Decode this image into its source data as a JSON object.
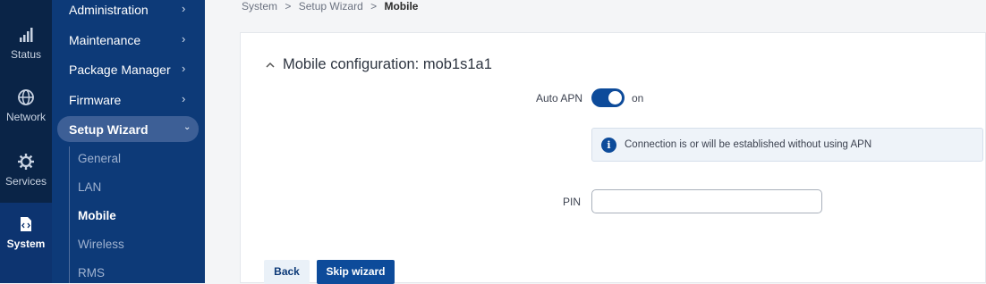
{
  "rail": {
    "items": [
      {
        "label": "Status",
        "icon": "signal-icon"
      },
      {
        "label": "Network",
        "icon": "globe-icon"
      },
      {
        "label": "Services",
        "icon": "gear-icon"
      },
      {
        "label": "System",
        "icon": "system-icon"
      }
    ]
  },
  "menu": {
    "items": [
      {
        "label": "Administration"
      },
      {
        "label": "Maintenance"
      },
      {
        "label": "Package Manager"
      },
      {
        "label": "Firmware"
      },
      {
        "label": "Setup Wizard"
      }
    ],
    "chevron": "›",
    "open_chevron": "⌄",
    "sub_items": [
      "General",
      "LAN",
      "Mobile",
      "Wireless",
      "RMS"
    ]
  },
  "breadcrumb": {
    "items": [
      "System",
      "Setup Wizard",
      "Mobile"
    ],
    "separator": ">"
  },
  "section": {
    "title": "Mobile configuration: mob1s1a1"
  },
  "form": {
    "auto_apn_label": "Auto APN",
    "auto_apn_state": "on",
    "info_icon": "i",
    "info_text": "Connection is or will be established without using APN",
    "pin_label": "PIN",
    "pin_value": ""
  },
  "buttons": {
    "back": "Back",
    "skip": "Skip wizard"
  },
  "colors": {
    "rail_bg": "#0a2447",
    "menu_bg": "#0d3a78",
    "accent": "#0d4b9a"
  }
}
